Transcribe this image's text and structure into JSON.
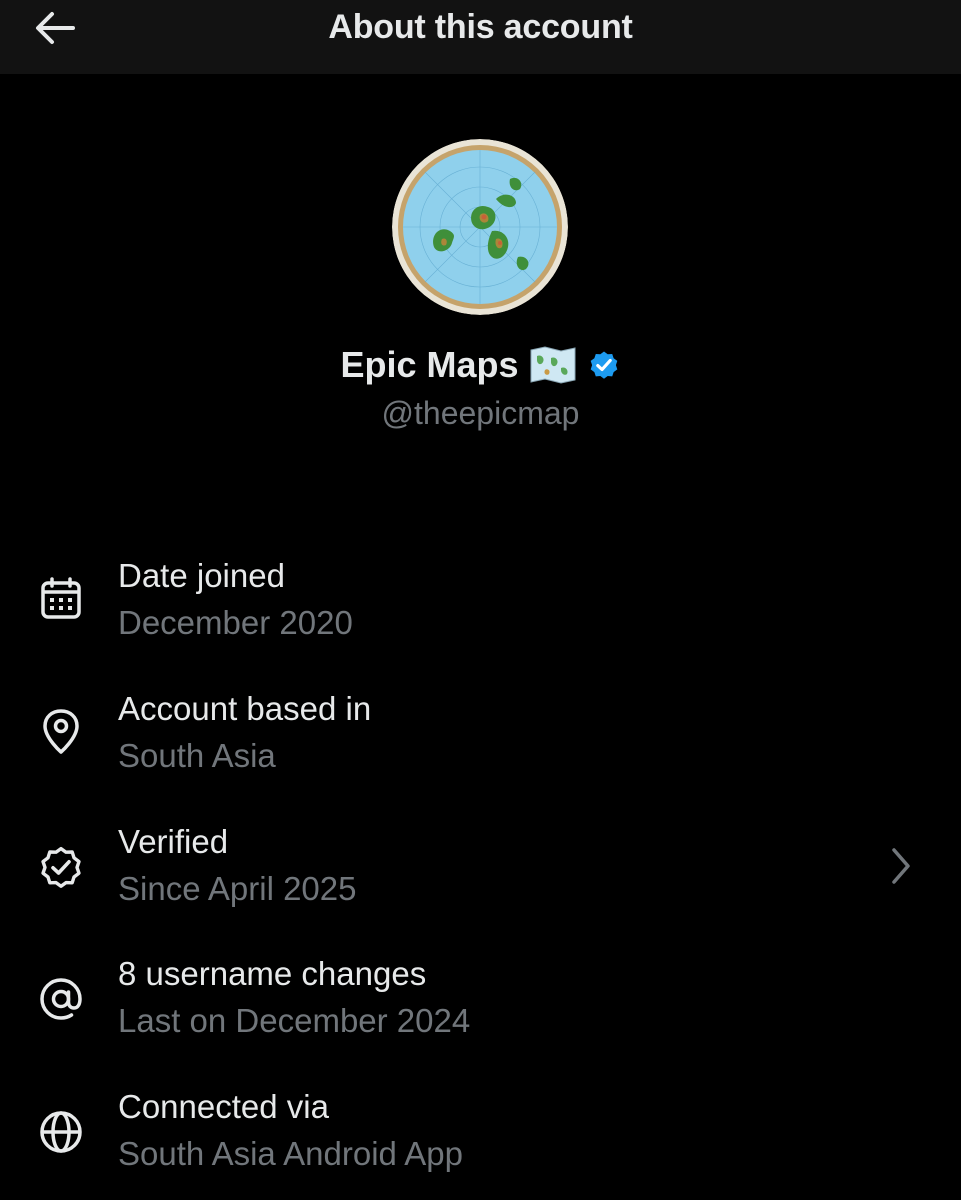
{
  "header": {
    "title": "About this account",
    "back_icon": "arrow-left-icon"
  },
  "profile": {
    "display_name": "Epic Maps",
    "name_emoji": "world-map-emoji",
    "verified": true,
    "badge_color": "#1d9bf0",
    "handle": "@theepicmap"
  },
  "details": [
    {
      "icon": "calendar-icon",
      "title": "Date joined",
      "value": "December 2020"
    },
    {
      "icon": "location-pin-icon",
      "title": "Account based in",
      "value": "South Asia"
    },
    {
      "icon": "verified-badge-icon",
      "title": "Verified",
      "value": "Since April 2025",
      "has_chevron": true
    },
    {
      "icon": "at-sign-icon",
      "title": "8 username changes",
      "value": "Last on December 2024"
    },
    {
      "icon": "globe-icon",
      "title": "Connected via",
      "value": "South Asia Android App"
    }
  ],
  "colors": {
    "background": "#000000",
    "header_background": "#121212",
    "primary_text": "#e7e9ea",
    "secondary_text": "#71767b",
    "accent": "#1d9bf0"
  }
}
